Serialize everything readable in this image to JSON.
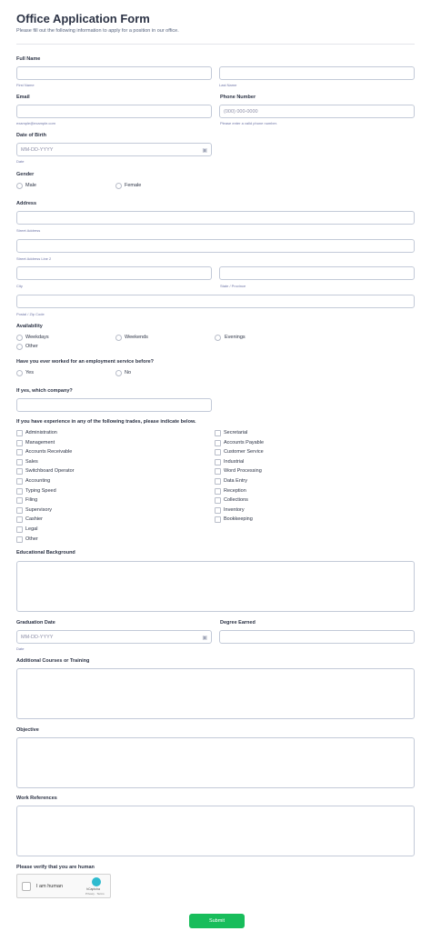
{
  "form": {
    "title": "Office Application Form",
    "subtitle": "Please fill out the following information to apply for a position in our office."
  },
  "full_name": {
    "label": "Full Name",
    "first_sub": "First Name",
    "last_sub": "Last Name"
  },
  "email": {
    "label": "Email",
    "sub": "example@example.com"
  },
  "phone": {
    "label": "Phone Number",
    "placeholder": "(000) 000-0000",
    "sub": "Please enter a valid phone number."
  },
  "dob": {
    "label": "Date of Birth",
    "placeholder": "MM-DD-YYYY",
    "sub": "Date"
  },
  "gender": {
    "label": "Gender",
    "options": [
      "Male",
      "Female"
    ]
  },
  "address": {
    "label": "Address",
    "street_sub": "Street Address",
    "street2_sub": "Street Address Line 2",
    "city_sub": "City",
    "state_sub": "State / Province",
    "zip_sub": "Postal / Zip Code"
  },
  "availability": {
    "label": "Availability",
    "options": [
      "Weekdays",
      "Weekends",
      "Evenings",
      "Other"
    ]
  },
  "employment_service": {
    "label": "Have you ever worked for an employment service before?",
    "options": [
      "Yes",
      "No"
    ]
  },
  "company": {
    "label": "If yes, which company?"
  },
  "trades": {
    "label": "If you have experience in any of the following trades, please indicate below.",
    "left": [
      "Administration",
      "Management",
      "Accounts Receivable",
      "Sales",
      "Switchboard Operator",
      "Accounting",
      "Typing Speed",
      "Filing",
      "Supervisory",
      "Cashier",
      "Legal",
      "Other"
    ],
    "right": [
      "Secretarial",
      "Accounts Payable",
      "Customer Service",
      "Industrial",
      "Word Processing",
      "Data Entry",
      "Reception",
      "Collections",
      "Inventory",
      "Bookkeeping"
    ]
  },
  "education": {
    "label": "Educational Background"
  },
  "graduation": {
    "label": "Graduation Date",
    "placeholder": "MM-DD-YYYY",
    "sub": "Date"
  },
  "degree": {
    "label": "Degree Earned"
  },
  "courses": {
    "label": "Additional Courses or Training"
  },
  "objective": {
    "label": "Objective"
  },
  "references": {
    "label": "Work References"
  },
  "verify": {
    "label": "Please verify that you are human",
    "captcha_text": "I am human",
    "captcha_brand": "hCaptcha",
    "captcha_links": "Privacy · Terms"
  },
  "submit": {
    "label": "Submit"
  },
  "colors": {
    "accent": "#18bd5b",
    "text": "#2c3345",
    "border": "#c3cad8"
  }
}
